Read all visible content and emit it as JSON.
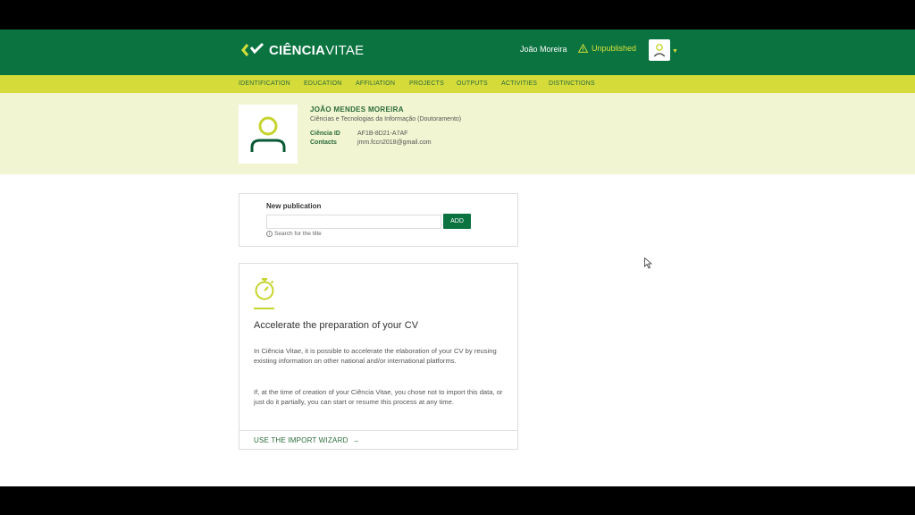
{
  "brand": {
    "name_bold": "CIÊNCIA",
    "name_light": "VITAE",
    "logo_icon": "chevron-logo-icon"
  },
  "header": {
    "user_name": "João Moreira",
    "status": "Unpublished",
    "status_icon": "warning-icon",
    "avatar_icon": "user-icon"
  },
  "nav": {
    "items": [
      "IDENTIFICATION",
      "EDUCATION",
      "AFFILIATION",
      "PROJECTS",
      "OUTPUTS",
      "ACTIVITIES",
      "DISTINCTIONS"
    ]
  },
  "profile": {
    "name": "JOÃO MENDES MOREIRA",
    "degree": "Ciências e Tecnologias da Informação (Doutoramento)",
    "ciencia_id_label": "Ciência ID",
    "ciencia_id": "AF1B-8D21-A7AF",
    "contacts_label": "Contacts",
    "contacts": "jmm.fccn2018@gmail.com"
  },
  "new_publication": {
    "label": "New publication",
    "input_value": "",
    "add_label": "ADD",
    "hint": "Search for the title"
  },
  "accelerate": {
    "title": "Accelerate the preparation of your CV",
    "para1": "In Ciência Vitae, it is possible to accelerate the elaboration of your CV by reusing existing information on other national and/or international platforms.",
    "para2": "If, at the time of creation of your Ciência Vitae, you chose not to import this data, or just do it partially, you can start or resume this process at any time.",
    "wizard_link": "USE THE IMPORT WIZARD",
    "icon": "stopwatch-icon"
  },
  "colors": {
    "primary": "#0a7340",
    "accent": "#d5dc3a",
    "profile_bg": "#f2f5d2"
  }
}
